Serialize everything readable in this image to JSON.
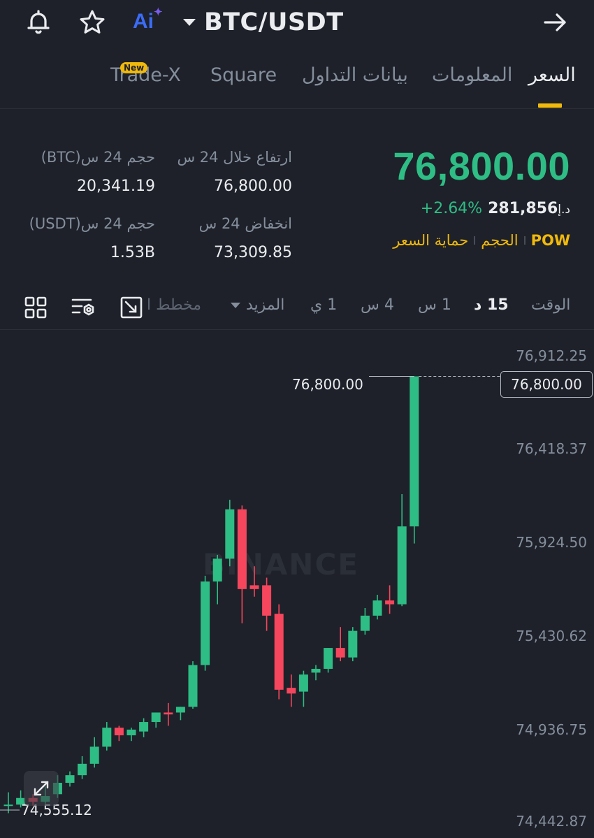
{
  "header": {
    "pair": "BTC/USDT",
    "ai_label": "Ai",
    "icons": [
      "bell-icon",
      "star-icon",
      "ai-icon",
      "caret-down-icon",
      "arrow-right-icon"
    ]
  },
  "tabs": [
    {
      "label": "السعر",
      "active": true
    },
    {
      "label": "المعلومات",
      "active": false
    },
    {
      "label": "بيانات التداول",
      "active": false
    },
    {
      "label": "Square",
      "active": false
    },
    {
      "label": "Trade-X",
      "active": false,
      "badge": "New"
    }
  ],
  "price": {
    "last": "76,800.00",
    "fiat": "281,856",
    "fiat_currency": "د.إ",
    "change": "+2.64%",
    "tags": [
      "POW",
      "الحجم",
      "حماية السعر"
    ]
  },
  "stats": {
    "high_label": "ارتفاع خلال 24 س",
    "high_value": "76,800.00",
    "low_label": "انخفاض 24 س",
    "low_value": "73,309.85",
    "vol_btc_label": "حجم 24 س(BTC)",
    "vol_btc_value": "20,341.19",
    "vol_usdt_label": "حجم 24 س(USDT)",
    "vol_usdt_value": "1.53B"
  },
  "intervals": {
    "time_label": "الوقت",
    "items": [
      "15 د",
      "1 س",
      "4 س",
      "1 ي"
    ],
    "active": "15 د",
    "more_label": "المزيد",
    "chart_type_label": "مخطط ا"
  },
  "chart": {
    "watermark": "BINANCE",
    "current_price_label": "76,800.00",
    "high_marker": "76,800.00",
    "low_marker": "74,555.12",
    "colors": {
      "up": "#2ebd85",
      "down": "#f6465d",
      "accent": "#f0b90b",
      "bg": "#1e2129"
    }
  },
  "chart_data": {
    "type": "candlestick",
    "y_ticks": [
      "76,912.25",
      "76,418.37",
      "75,924.50",
      "75,430.62",
      "74,936.75",
      "74,442.87"
    ],
    "ylim": [
      74442.87,
      76912.25
    ],
    "candles": [
      {
        "o": 74540,
        "h": 74610,
        "c": 74545,
        "l": 74500
      },
      {
        "o": 74545,
        "h": 74620,
        "c": 74580,
        "l": 74530
      },
      {
        "o": 74580,
        "h": 74600,
        "c": 74560,
        "l": 74540
      },
      {
        "o": 74560,
        "h": 74640,
        "c": 74590,
        "l": 74550
      },
      {
        "o": 74600,
        "h": 74700,
        "c": 74660,
        "l": 74580
      },
      {
        "o": 74660,
        "h": 74720,
        "c": 74700,
        "l": 74640
      },
      {
        "o": 74700,
        "h": 74800,
        "c": 74760,
        "l": 74680
      },
      {
        "o": 74760,
        "h": 74900,
        "c": 74850,
        "l": 74740
      },
      {
        "o": 74850,
        "h": 74980,
        "c": 74950,
        "l": 74830
      },
      {
        "o": 74950,
        "h": 74960,
        "c": 74910,
        "l": 74880
      },
      {
        "o": 74910,
        "h": 74950,
        "c": 74940,
        "l": 74880
      },
      {
        "o": 74930,
        "h": 75000,
        "c": 74980,
        "l": 74900
      },
      {
        "o": 74980,
        "h": 75030,
        "c": 75030,
        "l": 74950
      },
      {
        "o": 75030,
        "h": 75080,
        "c": 75020,
        "l": 74960
      },
      {
        "o": 75030,
        "h": 75060,
        "c": 75060,
        "l": 74990
      },
      {
        "o": 75060,
        "h": 75300,
        "c": 75280,
        "l": 75050
      },
      {
        "o": 75280,
        "h": 75750,
        "c": 75720,
        "l": 75250
      },
      {
        "o": 75720,
        "h": 75860,
        "c": 75840,
        "l": 75600
      },
      {
        "o": 75840,
        "h": 76150,
        "c": 76100,
        "l": 75800
      },
      {
        "o": 76100,
        "h": 76120,
        "c": 75680,
        "l": 75500
      },
      {
        "o": 75700,
        "h": 75800,
        "c": 75680,
        "l": 75640
      },
      {
        "o": 75700,
        "h": 75740,
        "c": 75540,
        "l": 75460
      },
      {
        "o": 75550,
        "h": 75600,
        "c": 75150,
        "l": 75100
      },
      {
        "o": 75160,
        "h": 75230,
        "c": 75130,
        "l": 75060
      },
      {
        "o": 75140,
        "h": 75250,
        "c": 75230,
        "l": 75060
      },
      {
        "o": 75240,
        "h": 75280,
        "c": 75260,
        "l": 75200
      },
      {
        "o": 75260,
        "h": 75370,
        "c": 75370,
        "l": 75240
      },
      {
        "o": 75370,
        "h": 75480,
        "c": 75320,
        "l": 75300
      },
      {
        "o": 75320,
        "h": 75480,
        "c": 75460,
        "l": 75300
      },
      {
        "o": 75460,
        "h": 75580,
        "c": 75540,
        "l": 75440
      },
      {
        "o": 75540,
        "h": 75650,
        "c": 75620,
        "l": 75520
      },
      {
        "o": 75620,
        "h": 75700,
        "c": 75600,
        "l": 75550
      },
      {
        "o": 75600,
        "h": 76180,
        "c": 76010,
        "l": 75590
      },
      {
        "o": 76010,
        "h": 76800,
        "c": 76800,
        "l": 75920
      }
    ]
  }
}
